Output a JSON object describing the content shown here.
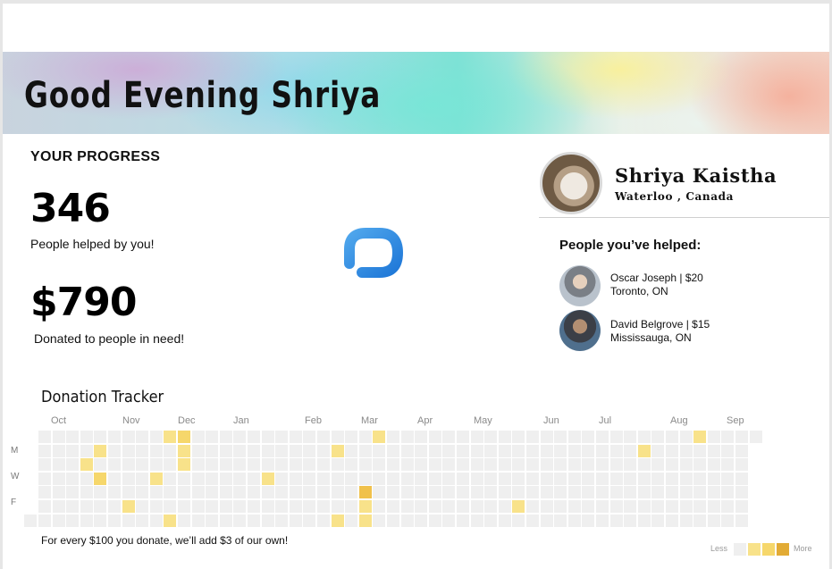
{
  "greeting": "Good Evening Shriya",
  "progress": {
    "title": "YOUR PROGRESS",
    "people_count": "346",
    "people_label": "People helped by you!",
    "donated_amount": "$790",
    "donated_label": "Donated to people in need!"
  },
  "logo_icon": "p-logo-icon",
  "profile": {
    "name": "Shriya Kaistha",
    "location": "Waterloo , Canada"
  },
  "helped": {
    "title": "People you’ve helped:",
    "people": [
      {
        "name_amount": "Oscar Joseph | $20",
        "city": "Toronto, ON"
      },
      {
        "name_amount": "David Belgrove | $15",
        "city": "Mississauga, ON"
      }
    ]
  },
  "tracker": {
    "title": "Donation Tracker",
    "months": [
      "Oct",
      "Nov",
      "Dec",
      "Jan",
      "Feb",
      "Mar",
      "Apr",
      "May",
      "Jun",
      "Jul",
      "Aug",
      "Sep"
    ],
    "day_labels": [
      "M",
      "W",
      "F"
    ],
    "note": "For every $100 you donate, we’ll add $3 of our own!",
    "legend_less": "Less",
    "legend_more": "More",
    "colors": {
      "empty": "#efefef",
      "level1": "#f8e28a",
      "level2": "#f6d76b",
      "level3": "#f0c14b",
      "level4": "#e2ab35"
    },
    "active_cells": [
      {
        "week": 9,
        "day": 0,
        "level": 1
      },
      {
        "week": 10,
        "day": 0,
        "level": 2
      },
      {
        "week": 4,
        "day": 1,
        "level": 1
      },
      {
        "week": 10,
        "day": 1,
        "level": 1
      },
      {
        "week": 3,
        "day": 2,
        "level": 1
      },
      {
        "week": 10,
        "day": 2,
        "level": 1
      },
      {
        "week": 4,
        "day": 3,
        "level": 2
      },
      {
        "week": 8,
        "day": 3,
        "level": 1
      },
      {
        "week": 16,
        "day": 3,
        "level": 1
      },
      {
        "week": 23,
        "day": 4,
        "level": 3
      },
      {
        "week": 6,
        "day": 5,
        "level": 1
      },
      {
        "week": 23,
        "day": 5,
        "level": 1
      },
      {
        "week": 34,
        "day": 5,
        "level": 1
      },
      {
        "week": 9,
        "day": 6,
        "level": 1
      },
      {
        "week": 21,
        "day": 6,
        "level": 1
      },
      {
        "week": 23,
        "day": 6,
        "level": 1
      },
      {
        "week": 21,
        "day": 1,
        "level": 1
      },
      {
        "week": 24,
        "day": 0,
        "level": 1
      },
      {
        "week": 43,
        "day": 1,
        "level": 1
      },
      {
        "week": 47,
        "day": 0,
        "level": 1
      }
    ]
  }
}
